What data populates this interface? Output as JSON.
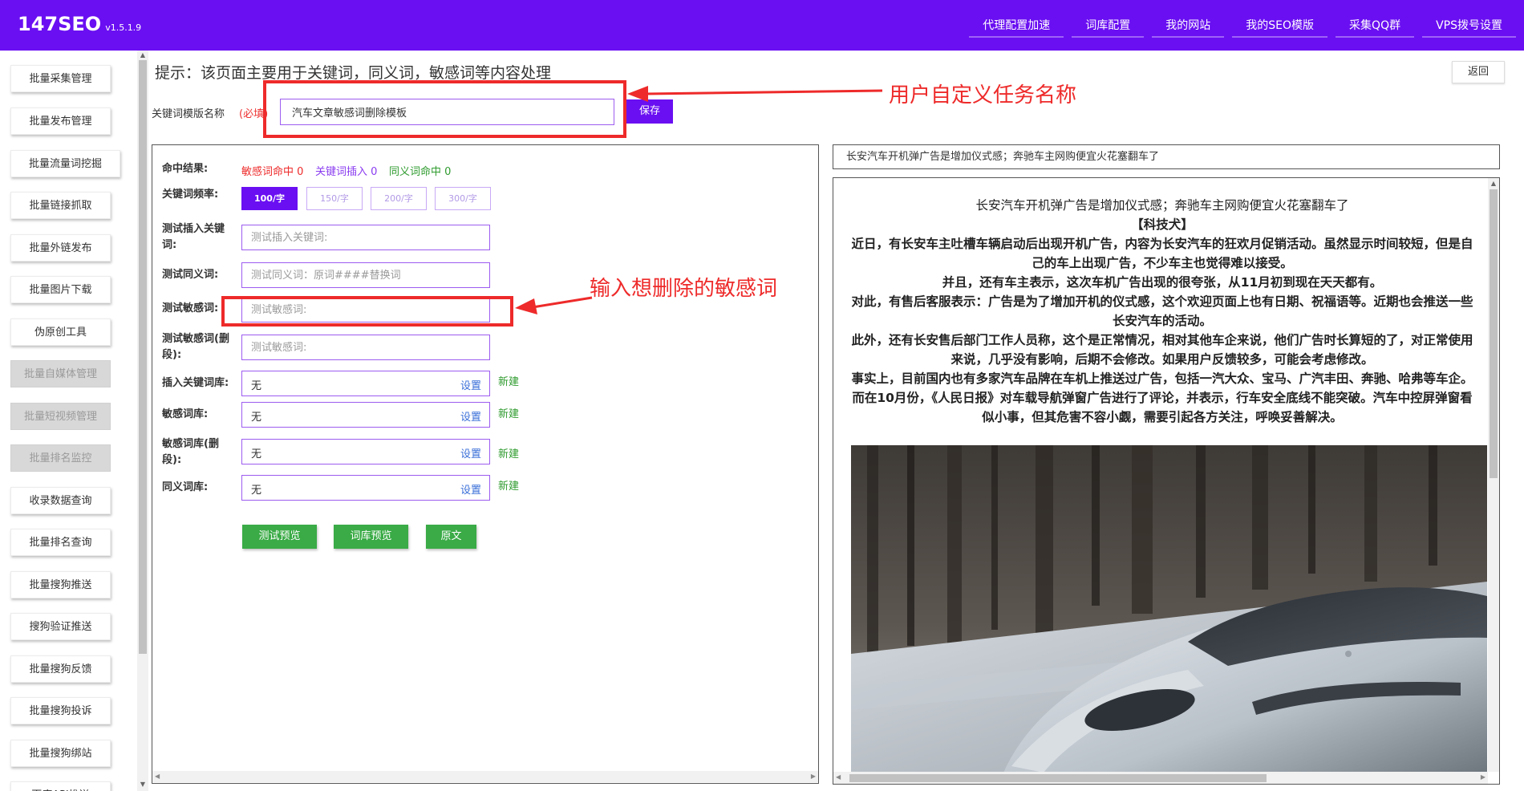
{
  "app": {
    "name": "147SEO",
    "version": "v1.5.1.9"
  },
  "topnav": [
    {
      "label": "代理配置加速"
    },
    {
      "label": "词库配置"
    },
    {
      "label": "我的网站"
    },
    {
      "label": "我的SEO模版"
    },
    {
      "label": "采集QQ群"
    },
    {
      "label": "VPS拨号设置"
    }
  ],
  "sidebar": {
    "items": [
      {
        "label": "批量采集管理",
        "disabled": false
      },
      {
        "label": "批量发布管理",
        "disabled": false
      },
      {
        "label": "批量流量词挖掘",
        "disabled": false
      },
      {
        "label": "批量链接抓取",
        "disabled": false
      },
      {
        "label": "批量外链发布",
        "disabled": false
      },
      {
        "label": "批量图片下载",
        "disabled": false
      },
      {
        "label": "伪原创工具",
        "disabled": false
      },
      {
        "label": "批量自媒体管理",
        "disabled": true
      },
      {
        "label": "批量短视频管理",
        "disabled": true
      },
      {
        "label": "批量排名监控",
        "disabled": true
      },
      {
        "label": "收录数据查询",
        "disabled": false
      },
      {
        "label": "批量排名查询",
        "disabled": false
      },
      {
        "label": "批量搜狗推送",
        "disabled": false
      },
      {
        "label": "搜狗验证推送",
        "disabled": false
      },
      {
        "label": "批量搜狗反馈",
        "disabled": false
      },
      {
        "label": "批量搜狗投诉",
        "disabled": false
      },
      {
        "label": "批量搜狗绑站",
        "disabled": false
      },
      {
        "label": "百度API推送",
        "disabled": false
      }
    ]
  },
  "header": {
    "hint": "提示：该页面主要用于关键词，同义词，敏感词等内容处理",
    "back_label": "返回"
  },
  "template": {
    "label": "关键词模版名称",
    "required": "(必填)",
    "value": "汽车文章敏感词删除模板",
    "save_label": "保存"
  },
  "annotations": {
    "task_name": "用户自定义任务名称",
    "sensitive": "输入想删除的敏感词"
  },
  "test_panel": {
    "result_label": "命中结果:",
    "result_sensitive": "敏感词命中 0",
    "result_keyword": "关键词插入 0",
    "result_synonym": "同义词命中 0",
    "freq_label": "关键词频率:",
    "freq_options": [
      "100/字",
      "150/字",
      "200/字",
      "300/字"
    ],
    "insert_kw_label": "测试插入关键词:",
    "insert_kw_placeholder": "测试插入关键词:",
    "synonym_label": "测试同义词:",
    "synonym_placeholder": "测试同义词：原词####替换词",
    "sensitive_label": "测试敏感词:",
    "sensitive_placeholder": "测试敏感词:",
    "sensitive_seg_label": "测试敏感词(删段):",
    "sensitive_seg_placeholder": "测试敏感词:",
    "libraries": [
      {
        "label": "插入关键词库:",
        "value": "无",
        "set": "设置",
        "new": "新建"
      },
      {
        "label": "敏感词库:",
        "value": "无",
        "set": "设置",
        "new": "新建"
      },
      {
        "label": "敏感词库(删段):",
        "value": "无",
        "set": "设置",
        "new": "新建"
      },
      {
        "label": "同义词库:",
        "value": "无",
        "set": "设置",
        "new": "新建"
      }
    ],
    "buttons": {
      "test_preview": "测试预览",
      "lib_preview": "词库预览",
      "original": "原文"
    }
  },
  "preview": {
    "title_bar": "长安汽车开机弹广告是增加仪式感；奔驰车主网购便宜火花塞翻车了",
    "article_title": "长安汽车开机弹广告是增加仪式感；奔驰车主网购便宜火花塞翻车了",
    "source": "【科技犬】",
    "paragraphs": [
      "近日，有长安车主吐槽车辆启动后出现开机广告，内容为长安汽车的狂欢月促销活动。虽然显示时间较短，但是自己的车上出现广告，不少车主也觉得难以接受。",
      "并且，还有车主表示，这次车机广告出现的很夸张，从11月初到现在天天都有。",
      "对此，有售后客服表示：广告是为了增加开机的仪式感，这个欢迎页面上也有日期、祝福语等。近期也会推送一些长安汽车的活动。",
      "此外，还有长安售后部门工作人员称，这个是正常情况，相对其他车企来说，他们广告时长算短的了，对正常使用来说，几乎没有影响，后期不会修改。如果用户反馈较多，可能会考虑修改。",
      "事实上，目前国内也有多家汽车品牌在车机上推送过广告，包括一汽大众、宝马、广汽丰田、奔驰、哈弗等车企。",
      "而在10月份，《人民日报》对车载导航弹窗广告进行了评论，并表示，行车安全底线不能突破。汽车中控屏弹窗看似小事，但其危害不容小觑，需要引起各方关注，呼唤妥善解决。"
    ]
  },
  "colors": {
    "brand": "#6a0ff2",
    "annotation": "#ee2a2a",
    "green": "#3aab46"
  }
}
